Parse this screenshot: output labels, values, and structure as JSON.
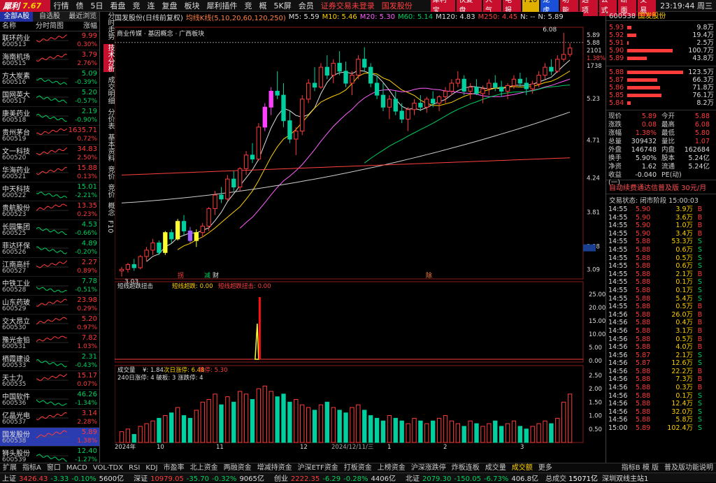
{
  "app": {
    "name": "犀利",
    "version": "7.67",
    "time": "23:19:44",
    "weekday": "周三"
  },
  "menu": {
    "items": [
      "行情",
      "债",
      "5日",
      "看盘",
      "竞",
      "连",
      "复盘",
      "板块",
      "犀利插件",
      "竞",
      "概",
      "5K屏",
      "会员"
    ],
    "notice": "证券交易未登录",
    "stock": "国发股份",
    "buttons": [
      "犀利宝",
      "快复盘",
      "人气",
      "电报",
      "F10",
      "龙虎",
      "功能",
      "选项",
      "公式",
      "断面",
      "交易"
    ],
    "right": [
      "复盘",
      "多股",
      "统计",
      "竞线",
      "快捷",
      "标记"
    ]
  },
  "left": {
    "tabs": [
      "全部A股",
      "自选股",
      "最近浏览"
    ],
    "head": {
      "name": "名称",
      "chart": "分时简图",
      "pct": "涨幅"
    },
    "stocks": [
      {
        "name": "联环药业",
        "code": "600513",
        "price": "9.99",
        "pct": "0.30%",
        "up": true
      },
      {
        "name": "海南机场",
        "code": "600515",
        "price": "3.79",
        "pct": "2.76%",
        "up": true
      },
      {
        "name": "方大炭素",
        "code": "600516",
        "price": "5.09",
        "pct": "-0.39%",
        "up": false
      },
      {
        "name": "国网英大",
        "code": "600517",
        "price": "5.20",
        "pct": "-0.57%",
        "up": false
      },
      {
        "name": "康美药业",
        "code": "600518",
        "price": "2.19",
        "pct": "-0.90%",
        "up": false
      },
      {
        "name": "贵州茅台",
        "code": "600519",
        "price": "1635.71",
        "pct": "0.72%",
        "up": true
      },
      {
        "name": "文一科技",
        "code": "600520",
        "price": "34.83",
        "pct": "2.50%",
        "up": true
      },
      {
        "name": "华海药业",
        "code": "600521",
        "price": "15.88",
        "pct": "0.13%",
        "up": true
      },
      {
        "name": "中天科技",
        "code": "600522",
        "price": "15.01",
        "pct": "-2.21%",
        "up": false
      },
      {
        "name": "贵航股份",
        "code": "600523",
        "price": "13.35",
        "pct": "0.23%",
        "up": true
      },
      {
        "name": "长园集团",
        "code": "600525",
        "price": "4.53",
        "pct": "-0.66%",
        "up": false
      },
      {
        "name": "菲达环保",
        "code": "600526",
        "price": "4.89",
        "pct": "-0.20%",
        "up": false
      },
      {
        "name": "江南高纤",
        "code": "600527",
        "price": "2.27",
        "pct": "0.89%",
        "up": true
      },
      {
        "name": "中铁工业",
        "code": "600528",
        "price": "7.78",
        "pct": "-0.51%",
        "up": false
      },
      {
        "name": "山东药玻",
        "code": "600529",
        "price": "23.98",
        "pct": "0.29%",
        "up": true
      },
      {
        "name": "交大昂立",
        "code": "600530",
        "price": "5.20",
        "pct": "0.97%",
        "up": true
      },
      {
        "name": "豫光金铅",
        "code": "600531",
        "price": "7.82",
        "pct": "1.03%",
        "up": true
      },
      {
        "name": "栖霞建设",
        "code": "600533",
        "price": "2.31",
        "pct": "-0.43%",
        "up": false
      },
      {
        "name": "天士力",
        "code": "600535",
        "price": "15.17",
        "pct": "0.07%",
        "up": true
      },
      {
        "name": "中国软件",
        "code": "600536",
        "price": "46.26",
        "pct": "-1.34%",
        "up": false
      },
      {
        "name": "亿晶光电",
        "code": "600537",
        "price": "3.14",
        "pct": "2.28%",
        "up": true
      },
      {
        "name": "国发股份",
        "code": "600538",
        "price": "5.89",
        "pct": "1.38%",
        "up": true,
        "selected": true
      },
      {
        "name": "狮头股份",
        "code": "600539",
        "price": "12.40",
        "pct": "-1.27%",
        "up": false
      }
    ]
  },
  "sidetabs": [
    "分时走势",
    "技术分析",
    "成交明细",
    "分价表",
    "基本资料",
    "竞价",
    "竞价",
    "概念",
    "F10"
  ],
  "chart": {
    "header_items": [
      "国发股份(日线前复权)",
      "均线K线(5,10,20,60,120,250)",
      "M5: 5.59",
      "M10: 5.46",
      "M20: 5.30",
      "M60: 5.14",
      "M120: 4.83",
      "M250: 4.45",
      "N: --",
      "N: 5.89"
    ],
    "concept": "商业传媒 · 基因概念 · 广西板块",
    "price_ticks": [
      "5.89",
      "5.88",
      "2101",
      "1.38%",
      "1738",
      "5.23",
      "4.71",
      "4.24",
      "3.81",
      "3.38",
      "3.09"
    ],
    "high_label": "6.08",
    "low_label": "3.03",
    "markers": [
      "拐",
      "减",
      "财",
      "除"
    ],
    "x_labels": [
      "2024年",
      "10",
      "11",
      "12",
      "2024/12/11/三",
      "1",
      "2",
      "3"
    ],
    "indicator": {
      "name": "短线超跌扭击",
      "l1": "短线超跌: 0.00",
      "l2": "短线超跌扭击: 0.00",
      "ticks": [
        "25.00",
        "20.00",
        "15.00",
        "10.00",
        "5.00",
        "0.00"
      ]
    },
    "volume": {
      "name": "成交量",
      "l1": "¥: 1.84",
      "l2": "次日涨停: 6.48",
      "l3": "跌停: 5.30",
      "sub": "240日涨停: 4 破板: 3 涨跌停: 4",
      "ticks": [
        "2.50",
        "2.00",
        "1.50",
        "1.00",
        "0.50"
      ]
    },
    "chart_data": {
      "type": "candlestick",
      "ohlc": [
        [
          3.1,
          3.15,
          3.03,
          3.12
        ],
        [
          3.12,
          3.2,
          3.08,
          3.18
        ],
        [
          3.18,
          3.25,
          3.1,
          3.14
        ],
        [
          3.14,
          3.3,
          3.12,
          3.28
        ],
        [
          3.28,
          3.4,
          3.22,
          3.36
        ],
        [
          3.36,
          3.5,
          3.3,
          3.45
        ],
        [
          3.45,
          3.48,
          3.3,
          3.33
        ],
        [
          3.33,
          3.6,
          3.3,
          3.58
        ],
        [
          3.58,
          3.62,
          3.45,
          3.5
        ],
        [
          3.5,
          3.75,
          3.48,
          3.72
        ],
        [
          3.72,
          3.8,
          3.55,
          3.6
        ],
        [
          3.6,
          3.65,
          3.45,
          3.48
        ],
        [
          3.48,
          3.62,
          3.4,
          3.58
        ],
        [
          3.58,
          3.7,
          3.52,
          3.66
        ],
        [
          3.66,
          3.9,
          3.6,
          3.88
        ],
        [
          3.88,
          4.1,
          3.8,
          4.05
        ],
        [
          4.05,
          4.15,
          3.95,
          4.0
        ],
        [
          4.0,
          4.3,
          3.98,
          4.25
        ],
        [
          4.25,
          4.35,
          4.1,
          4.15
        ],
        [
          4.15,
          4.4,
          4.1,
          4.38
        ],
        [
          4.38,
          4.6,
          4.3,
          4.55
        ],
        [
          4.55,
          4.7,
          4.45,
          4.5
        ],
        [
          4.5,
          4.95,
          4.48,
          4.9
        ],
        [
          4.9,
          5.2,
          4.85,
          5.15
        ],
        [
          5.15,
          5.4,
          5.05,
          5.35
        ],
        [
          5.35,
          5.6,
          5.25,
          5.3
        ],
        [
          5.3,
          5.45,
          4.9,
          4.98
        ],
        [
          4.98,
          5.1,
          4.7,
          4.75
        ],
        [
          4.75,
          4.9,
          4.55,
          4.85
        ],
        [
          4.85,
          5.3,
          4.8,
          5.25
        ],
        [
          5.25,
          5.5,
          5.2,
          5.45
        ],
        [
          5.45,
          5.65,
          5.35,
          5.4
        ],
        [
          5.4,
          5.7,
          5.38,
          5.65
        ],
        [
          5.65,
          5.8,
          5.5,
          5.55
        ],
        [
          5.55,
          5.75,
          5.45,
          5.7
        ],
        [
          5.7,
          5.85,
          5.55,
          5.6
        ],
        [
          5.6,
          5.72,
          5.4,
          5.45
        ],
        [
          5.45,
          5.6,
          5.3,
          5.55
        ],
        [
          5.55,
          5.8,
          5.5,
          5.75
        ],
        [
          5.75,
          5.9,
          5.6,
          5.65
        ],
        [
          5.65,
          5.7,
          5.4,
          5.45
        ],
        [
          5.45,
          5.55,
          5.25,
          5.3
        ],
        [
          5.3,
          5.45,
          5.1,
          5.15
        ],
        [
          5.15,
          5.3,
          5.0,
          5.25
        ],
        [
          5.25,
          5.35,
          5.05,
          5.1
        ],
        [
          5.1,
          5.2,
          4.95,
          5.0
        ],
        [
          5.0,
          5.15,
          4.85,
          5.12
        ],
        [
          5.12,
          5.25,
          5.05,
          5.2
        ],
        [
          5.2,
          5.3,
          5.1,
          5.15
        ],
        [
          5.15,
          5.28,
          5.08,
          5.25
        ],
        [
          5.25,
          5.35,
          5.15,
          5.2
        ],
        [
          5.2,
          5.3,
          5.1,
          5.28
        ],
        [
          5.28,
          5.4,
          5.2,
          5.35
        ],
        [
          5.35,
          5.5,
          5.3,
          5.45
        ],
        [
          5.45,
          5.6,
          5.4,
          5.5
        ],
        [
          5.5,
          5.55,
          5.3,
          5.35
        ],
        [
          5.35,
          5.45,
          5.25,
          5.4
        ],
        [
          5.4,
          5.5,
          5.3,
          5.32
        ],
        [
          5.32,
          5.42,
          5.2,
          5.38
        ],
        [
          5.38,
          5.5,
          5.3,
          5.45
        ],
        [
          5.45,
          5.55,
          5.35,
          5.4
        ],
        [
          5.4,
          5.48,
          5.28,
          5.35
        ],
        [
          5.35,
          5.45,
          5.25,
          5.42
        ],
        [
          5.42,
          5.55,
          5.38,
          5.5
        ],
        [
          5.5,
          5.58,
          5.4,
          5.45
        ],
        [
          5.45,
          5.52,
          5.3,
          5.38
        ],
        [
          5.38,
          5.48,
          5.32,
          5.44
        ],
        [
          5.44,
          5.6,
          5.4,
          5.55
        ],
        [
          5.55,
          5.7,
          5.5,
          5.65
        ],
        [
          5.65,
          5.75,
          5.55,
          5.6
        ],
        [
          5.6,
          5.8,
          5.58,
          5.75
        ],
        [
          5.75,
          6.08,
          5.72,
          5.81
        ],
        [
          5.81,
          5.95,
          5.78,
          5.89
        ]
      ],
      "volume": [
        0.4,
        0.5,
        0.3,
        0.6,
        0.7,
        0.8,
        0.9,
        1.0,
        1.1,
        1.3,
        1.0,
        0.9,
        1.2,
        1.5,
        1.6,
        1.8,
        1.4,
        1.7,
        1.5,
        1.9,
        1.8,
        1.6,
        2.0,
        2.1,
        1.9,
        1.7,
        1.8,
        1.5,
        1.6,
        1.4,
        1.3,
        1.2,
        1.4,
        1.5,
        1.3,
        1.2,
        1.1,
        1.3,
        1.4,
        1.2,
        1.0,
        0.9,
        0.8,
        1.0,
        0.9,
        0.8,
        0.7,
        0.9,
        0.8,
        0.7,
        0.8,
        0.9,
        1.0,
        0.8,
        0.7,
        0.6,
        0.8,
        0.7,
        0.6,
        0.7,
        0.8,
        0.6,
        0.7,
        0.8,
        0.6,
        0.5,
        0.6,
        0.7,
        0.8,
        0.7,
        0.9,
        1.5,
        1.8
      ]
    }
  },
  "right": {
    "code": "600538",
    "name": "国发股份",
    "asks": [
      [
        "5.93",
        "9.8万"
      ],
      [
        "5.92",
        "19.4万"
      ],
      [
        "5.91",
        "2.5万"
      ],
      [
        "5.90",
        "100.7万"
      ],
      [
        "5.89",
        "43.8万"
      ]
    ],
    "bids": [
      [
        "5.88",
        "123.5万"
      ],
      [
        "5.87",
        "66.3万"
      ],
      [
        "5.86",
        "71.8万"
      ],
      [
        "5.85",
        "76.1万"
      ],
      [
        "5.84",
        "8.2万"
      ]
    ],
    "stats": [
      [
        "现价",
        "5.89",
        "今开",
        "5.88"
      ],
      [
        "涨跌",
        "0.08",
        "最高",
        "6.08"
      ],
      [
        "涨幅",
        "1.38%",
        "最低",
        "5.80"
      ],
      [
        "总量",
        "309432",
        "量比",
        "1.07"
      ],
      [
        "外盘",
        "146748",
        "内盘",
        "162684"
      ],
      [
        "换手",
        "5.90%",
        "股本",
        "5.24亿"
      ],
      [
        "净资",
        "1.62",
        "流通",
        "5.24亿"
      ],
      [
        "收益(一)",
        "-0.040",
        "PE(动)",
        ""
      ]
    ],
    "ad": "自动续费通达信普及版 30元/月",
    "trade_state": "交易状态: 闭市阶段 15:00:03",
    "ticks": [
      [
        "14:55",
        "5.90",
        "3.9万",
        "B"
      ],
      [
        "14:55",
        "5.90",
        "3.6万",
        "B"
      ],
      [
        "14:55",
        "5.90",
        "1.0万",
        "B"
      ],
      [
        "14:55",
        "5.90",
        "3.4万",
        "B"
      ],
      [
        "14:55",
        "5.88",
        "53.3万",
        "S"
      ],
      [
        "14:55",
        "5.88",
        "0.6万",
        "S"
      ],
      [
        "14:55",
        "5.88",
        "0.5万",
        "S"
      ],
      [
        "14:55",
        "5.88",
        "0.6万",
        "S"
      ],
      [
        "14:55",
        "5.88",
        "2.1万",
        "B"
      ],
      [
        "14:55",
        "5.88",
        "0.1万",
        "S"
      ],
      [
        "14:55",
        "5.88",
        "0.1万",
        "S"
      ],
      [
        "14:55",
        "5.88",
        "5.4万",
        "S"
      ],
      [
        "14:55",
        "5.88",
        "0.5万",
        "B"
      ],
      [
        "14:56",
        "5.88",
        "26.0万",
        "B"
      ],
      [
        "14:56",
        "5.88",
        "0.4万",
        "B"
      ],
      [
        "14:56",
        "5.88",
        "3.1万",
        "B"
      ],
      [
        "14:56",
        "5.88",
        "0.5万",
        "B"
      ],
      [
        "14:56",
        "5.88",
        "4.0万",
        "B"
      ],
      [
        "14:56",
        "5.87",
        "2.1万",
        "S"
      ],
      [
        "14:56",
        "5.87",
        "12.6万",
        "S"
      ],
      [
        "14:56",
        "5.88",
        "22.2万",
        "B"
      ],
      [
        "14:56",
        "5.88",
        "7.3万",
        "B"
      ],
      [
        "14:56",
        "5.88",
        "0.3万",
        "B"
      ],
      [
        "14:56",
        "5.88",
        "0.1万",
        "S"
      ],
      [
        "14:56",
        "5.88",
        "12.4万",
        "S"
      ],
      [
        "14:56",
        "5.88",
        "32.0万",
        "S"
      ],
      [
        "14:56",
        "5.88",
        "5.8万",
        "S"
      ],
      [
        "15:00",
        "5.89",
        "102.4万",
        "S"
      ]
    ]
  },
  "bottom": {
    "tabs": [
      "指标A",
      "窗口",
      "MACD",
      "VOL-TDX",
      "RSI",
      "KDJ",
      "市盈率",
      "北上资金",
      "两融资金",
      "增减持资金",
      "沪深ETF资金",
      "打板资金",
      "上榜资金",
      "沪深涨跌停",
      "炸板连板",
      "成交量",
      "成交额",
      "更多"
    ],
    "right": "指标B 模 版",
    "extra": "扩展",
    "extra2": "关联股份",
    "right2": "普及版功能说明"
  },
  "status": [
    {
      "label": "上证",
      "val": "3426.43",
      "chg": "-3.33",
      "pct": "-0.10%",
      "amt": "5600亿"
    },
    {
      "label": "深证",
      "val": "10979.05",
      "chg": "-35.70",
      "pct": "-0.32%",
      "amt": "9065亿"
    },
    {
      "label": "创业",
      "val": "2222.35",
      "chg": "-6.29",
      "pct": "-0.28%",
      "amt": "4406亿"
    },
    {
      "label": "北证",
      "val": "2079.30",
      "chg": "-150.05",
      "pct": "-6.73%",
      "amt": "406.8亿"
    }
  ],
  "status_extra": {
    "total": "总成交",
    "total_val": "15071亿",
    "site": "深圳双线主站1"
  }
}
